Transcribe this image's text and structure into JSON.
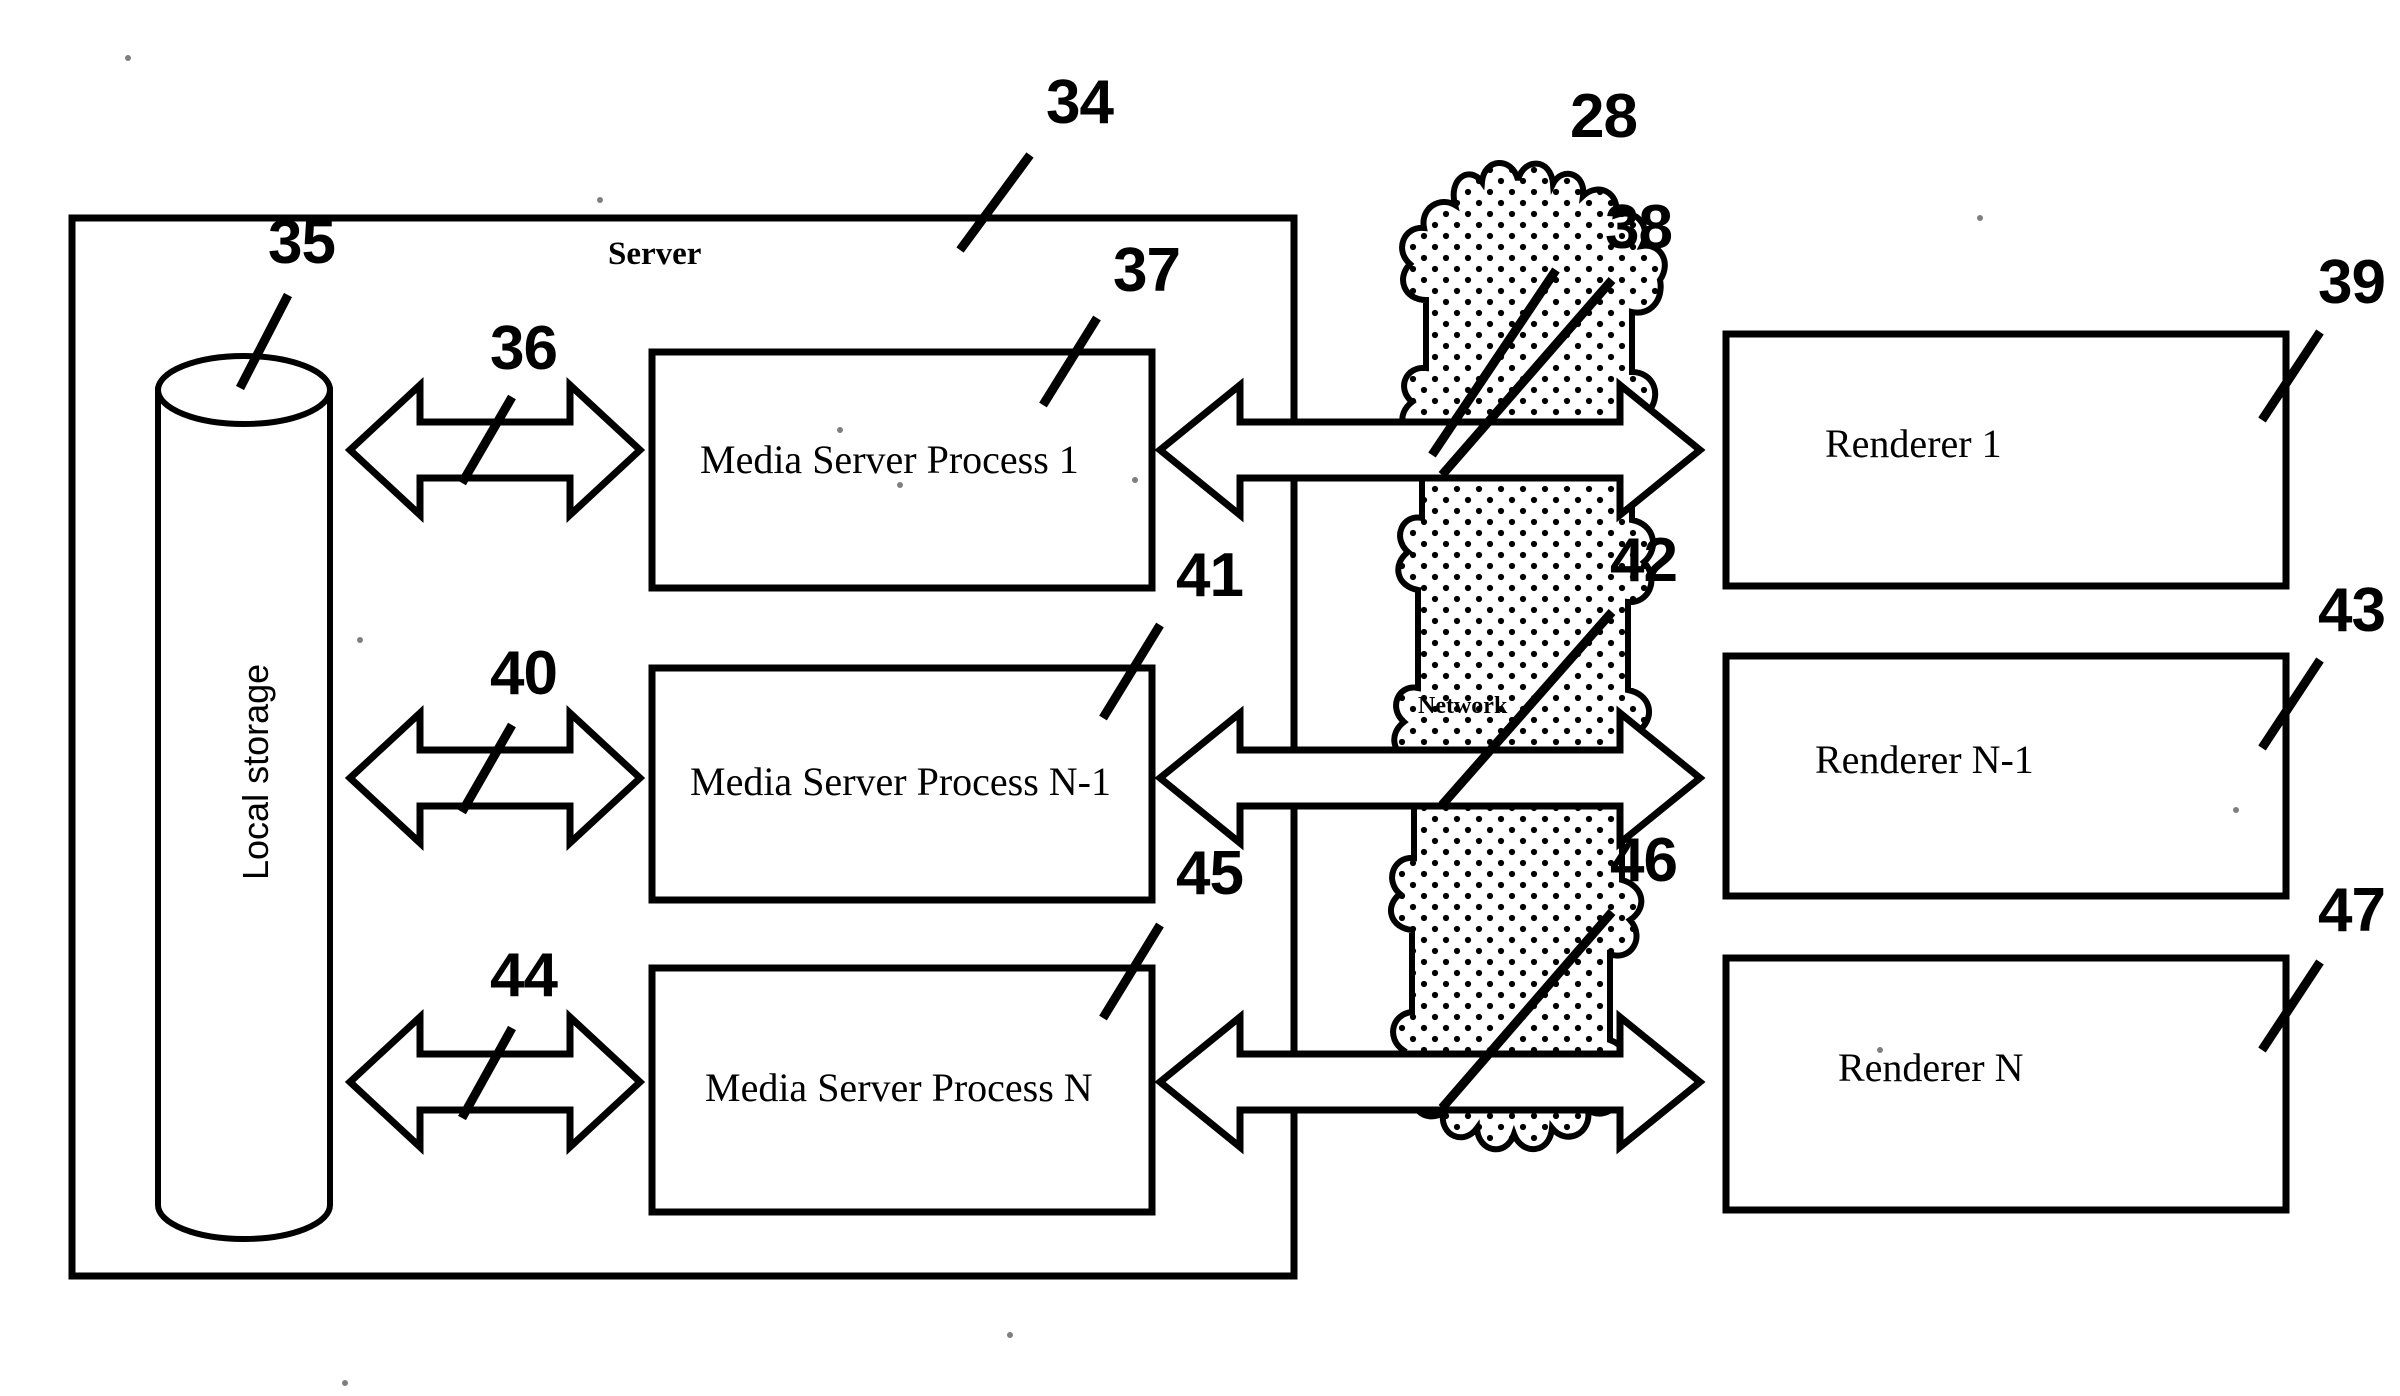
{
  "figure": {
    "kind": "patent-block-diagram",
    "background_color": "#ffffff",
    "ink_color": "#000000",
    "server_label": "Server",
    "network_label": "Network",
    "storage_label": "Local storage"
  },
  "server": {
    "label": "Server",
    "reference_numeral": "34",
    "storage": {
      "label": "Local storage",
      "reference_numeral": "35"
    },
    "processes": [
      {
        "label": "Media Server Process 1",
        "reference_numeral": "37",
        "link_numeral": "36"
      },
      {
        "label": "Media Server Process N-1",
        "reference_numeral": "41",
        "link_numeral": "40"
      },
      {
        "label": "Media Server Process N",
        "reference_numeral": "45",
        "link_numeral": "44"
      }
    ]
  },
  "network": {
    "label": "Network",
    "reference_numeral": "28"
  },
  "renderers": [
    {
      "label": "Renderer 1",
      "reference_numeral": "39",
      "link_numeral": "38"
    },
    {
      "label": "Renderer N-1",
      "reference_numeral": "43",
      "link_numeral": "42"
    },
    {
      "label": "Renderer N",
      "reference_numeral": "47",
      "link_numeral": "46"
    }
  ],
  "reference_numerals": {
    "server_box": "34",
    "local_storage": "35",
    "storage_link_1": "36",
    "process_1": "37",
    "network_link_1": "38",
    "renderer_1": "39",
    "storage_link_2": "40",
    "process_n_minus_1": "41",
    "network_link_2": "42",
    "renderer_n_minus_1": "43",
    "storage_link_3": "44",
    "process_n": "45",
    "network_link_3": "46",
    "renderer_n": "47",
    "network_cloud": "28"
  }
}
